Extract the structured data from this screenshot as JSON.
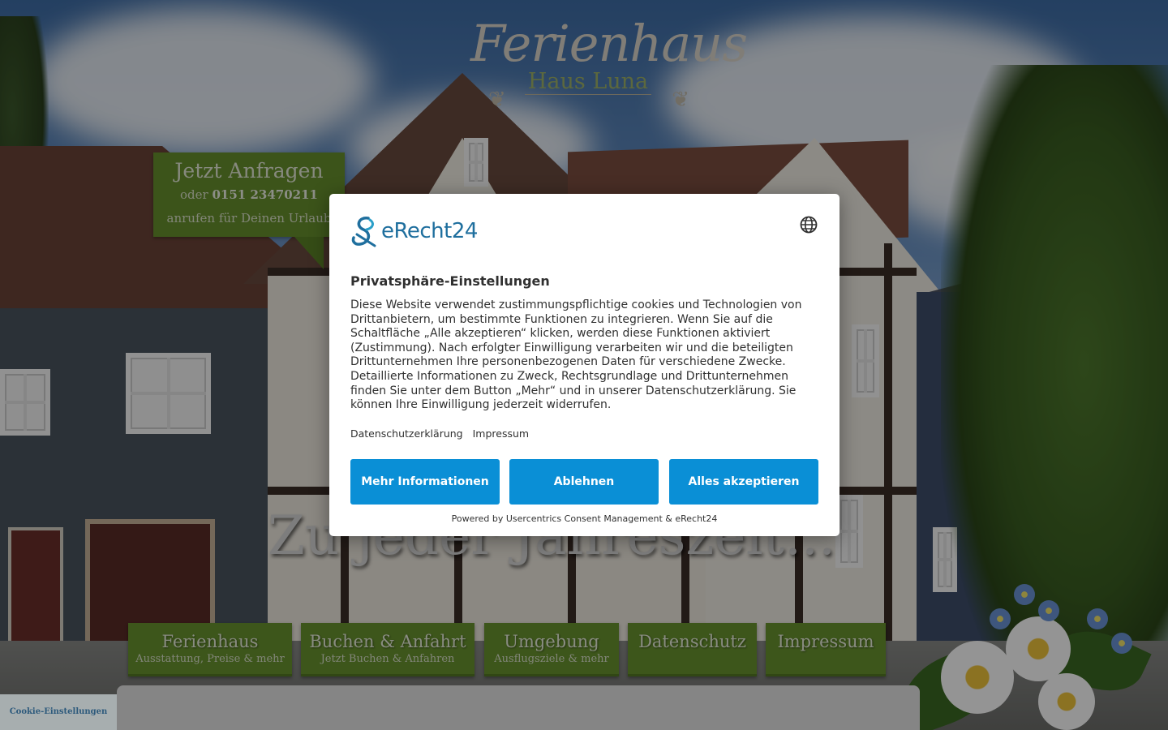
{
  "site": {
    "logo_script": "Ferienhaus",
    "logo_sub": "Haus Luna",
    "cta": {
      "title": "Jetzt Anfragen",
      "line1_prefix": "oder",
      "phone": "0151 23470211",
      "line2": "anrufen für Deinen Urlaub"
    },
    "tagline": "Zu jeder Jahreszeit...",
    "nav": [
      {
        "title": "Ferienhaus",
        "sub": "Ausstattung, Preise & mehr"
      },
      {
        "title": "Buchen & Anfahrt",
        "sub": "Jetzt Buchen & Anfahren"
      },
      {
        "title": "Umgebung",
        "sub": "Ausflugsziele & mehr"
      },
      {
        "title": "Datenschutz",
        "sub": ""
      },
      {
        "title": "Impressum",
        "sub": ""
      }
    ],
    "cookie_settings": "Cookie-Einstellungen"
  },
  "consent": {
    "brand": "eRecht24",
    "title": "Privatsphäre-Einstellungen",
    "body": "Diese Website verwendet zustimmungspflichtige cookies und Technologien von Drittanbietern, um bestimmte Funktionen zu integrieren. Wenn Sie auf die Schaltfläche „Alle akzeptieren“ klicken, werden diese Funktionen aktiviert (Zustimmung). Nach erfolgter Einwilligung verarbeiten wir und die beteiligten Drittunternehmen Ihre personenbezogenen Daten für verschiedene Zwecke. Detaillierte Informationen zu Zweck, Rechtsgrundlage und Drittunternehmen finden Sie unter dem Button „Mehr“ und in unserer Datenschutzerklärung. Sie können Ihre Einwilligung jederzeit widerrufen.",
    "links": {
      "privacy": "Datenschutzerklärung",
      "imprint": "Impressum"
    },
    "buttons": {
      "more": "Mehr Informationen",
      "deny": "Ablehnen",
      "accept": "Alles akzeptieren"
    },
    "powered_by": "Powered by Usercentrics Consent Management & eRecht24",
    "language_icon": "globe-icon"
  },
  "colors": {
    "consent_button": "#0a8fd6",
    "brand_teal": "#1f6f9e",
    "site_green": "#6a9530"
  }
}
